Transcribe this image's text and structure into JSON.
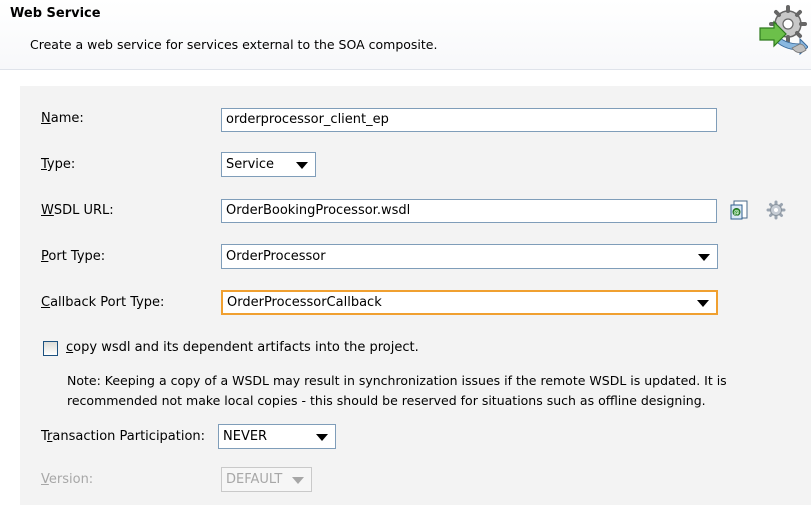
{
  "header": {
    "title": "Web Service",
    "description": "Create a web service for services external to the SOA composite.",
    "logo_icon": "web-service-gear-arrow-icon"
  },
  "form": {
    "name": {
      "mnemonic": "N",
      "rest": "ame:",
      "value": "orderprocessor_client_ep"
    },
    "type": {
      "mnemonic": "T",
      "rest": "ype:",
      "value": "Service"
    },
    "wsdl_url": {
      "mnemonic": "W",
      "rest": "SDL URL:",
      "value": "OrderBookingProcessor.wsdl",
      "browse_icon": "find-wsdl-icon",
      "settings_icon": "gear-icon"
    },
    "port_type": {
      "mnemonic": "P",
      "rest": "ort Type:",
      "value": "OrderProcessor"
    },
    "callback_port_type": {
      "mnemonic": "C",
      "rest": "allback Port Type:",
      "value": "OrderProcessorCallback"
    },
    "copy_wsdl": {
      "mnemonic": "c",
      "rest": "opy wsdl and its dependent artifacts into the project.",
      "checked": false
    },
    "note_line1": "Note: Keeping a copy of a WSDL may result in synchronization issues if the remote WSDL is updated. It is",
    "note_line2": "recommended not make local copies - this should be reserved for situations such as offline designing.",
    "transaction": {
      "pre": "T",
      "mnemonic": "r",
      "rest": "ansaction Participation:",
      "value": "NEVER"
    },
    "version": {
      "mnemonic": "V",
      "rest": "ersion:",
      "value": "DEFAULT",
      "disabled": true
    }
  },
  "colors": {
    "focus_border": "#f0a030",
    "field_border": "#7f9db9",
    "panel_bg": "#f3f3f3"
  }
}
